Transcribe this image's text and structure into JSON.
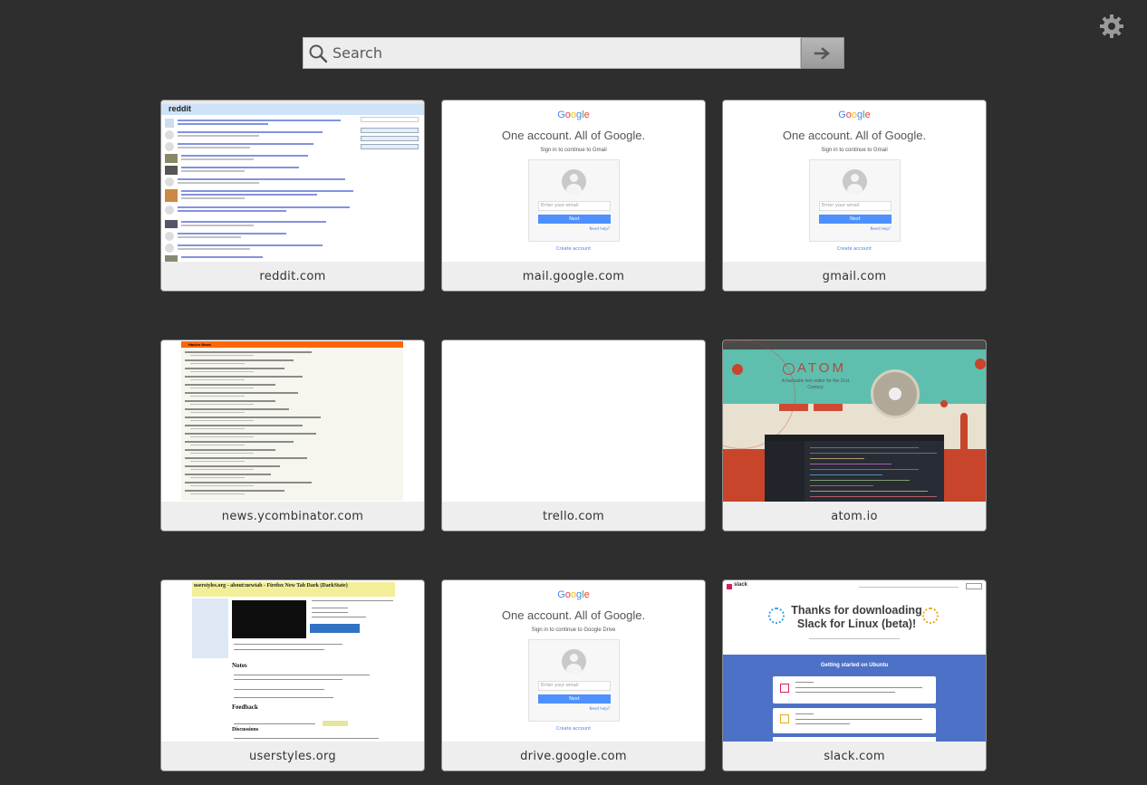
{
  "search": {
    "placeholder": "Search"
  },
  "tiles": [
    {
      "label": "reddit.com"
    },
    {
      "label": "mail.google.com"
    },
    {
      "label": "gmail.com"
    },
    {
      "label": "news.ycombinator.com"
    },
    {
      "label": "trello.com"
    },
    {
      "label": "atom.io"
    },
    {
      "label": "userstyles.org"
    },
    {
      "label": "drive.google.com"
    },
    {
      "label": "slack.com"
    }
  ],
  "thumbs": {
    "reddit": {
      "logo": "reddit"
    },
    "google": {
      "logo": "Google",
      "headline": "One account. All of Google.",
      "gmail_sub": "Sign in to continue to Gmail",
      "drive_sub": "Sign in to continue to Google Drive",
      "email_placeholder": "Enter your email",
      "next": "Next",
      "need_help": "Need help?",
      "create": "Create account"
    },
    "hn": {
      "title": "Hacker News"
    },
    "atom": {
      "logo": "ATOM",
      "tagline": "A hackable text editor for the 21st Century"
    },
    "userstyles": {
      "title": "userstyles.org - about:newtab - Firefox New Tab Dark (DarkState)",
      "notes": "Notes",
      "feedback": "Feedback",
      "discussions": "Discussions"
    },
    "slack": {
      "logo": "slack",
      "headline": "Thanks for downloading Slack for Linux (beta)!",
      "getting_started": "Getting started on Ubuntu"
    }
  }
}
